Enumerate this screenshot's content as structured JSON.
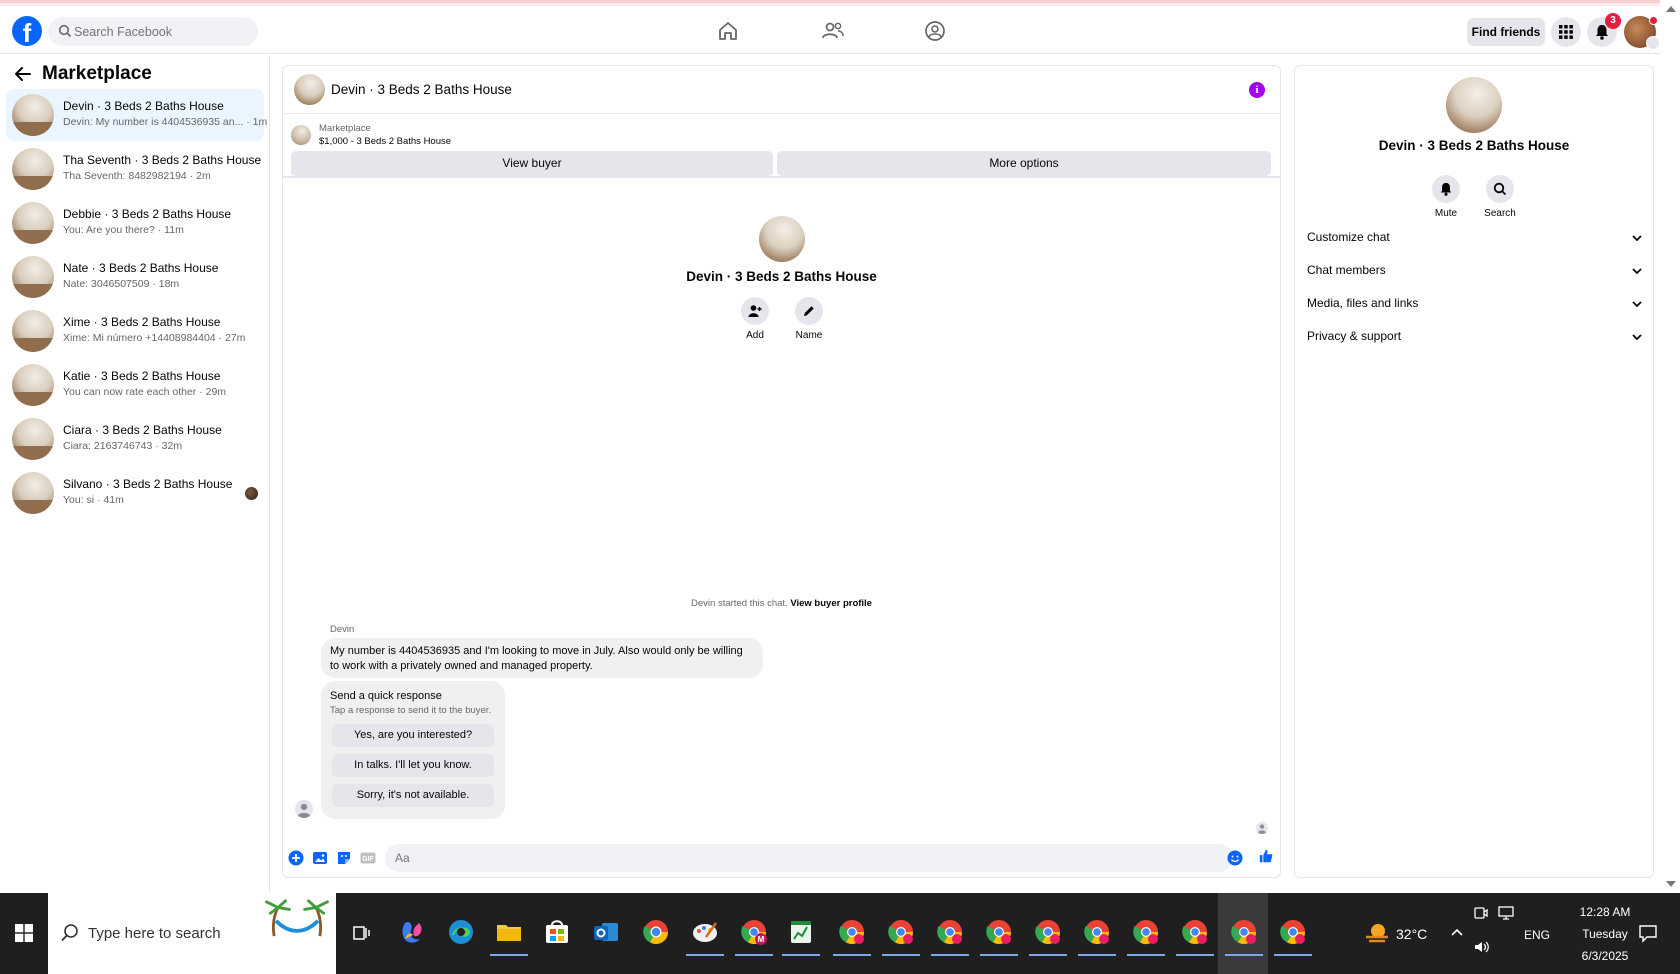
{
  "header": {
    "search_placeholder": "Search Facebook",
    "find_friends": "Find friends",
    "notification_count": "3"
  },
  "sidebar": {
    "title": "Marketplace",
    "conversations": [
      {
        "name": "Devin · 3 Beds 2 Baths House",
        "preview": "Devin: My number is 4404536935 an...  · 1m"
      },
      {
        "name": "Tha Seventh · 3 Beds 2 Baths House",
        "preview": "Tha Seventh: 8482982194 · 2m"
      },
      {
        "name": "Debbie · 3 Beds 2 Baths House",
        "preview": "You: Are you there? · 11m"
      },
      {
        "name": "Nate · 3 Beds 2 Baths House",
        "preview": "Nate: 3046507509 · 18m"
      },
      {
        "name": "Xime · 3 Beds 2 Baths House",
        "preview": "Xime: Mi número +14408984404 · 27m"
      },
      {
        "name": "Katie · 3 Beds 2 Baths House",
        "preview": "You can now rate each other · 29m"
      },
      {
        "name": "Ciara · 3 Beds 2 Baths House",
        "preview": "Ciara: 2163746743 · 32m"
      },
      {
        "name": "Silvano · 3 Beds 2 Baths House",
        "preview": "You: si · 41m"
      }
    ]
  },
  "chat": {
    "title": "Devin · 3 Beds 2 Baths House",
    "marketplace_label": "Marketplace",
    "listing": "$1,000 - 3 Beds 2 Baths House",
    "view_buyer": "View buyer",
    "more_options": "More options",
    "profile_name": "Devin · 3 Beds 2 Baths House",
    "add_label": "Add",
    "name_label": "Name",
    "started_text": "Devin started this chat.",
    "view_buyer_profile": "View buyer profile",
    "sender": "Devin",
    "message": "My number is 4404536935 and I'm looking to move in July. Also would only be willing to work with a privately owned and managed property.",
    "quick_title": "Send a quick response",
    "quick_sub": "Tap a response to send it to the buyer.",
    "quick_responses": [
      "Yes, are you interested?",
      "In talks. I'll let you know.",
      "Sorry, it's not available."
    ],
    "composer_placeholder": "Aa"
  },
  "info_panel": {
    "name": "Devin · 3 Beds 2 Baths House",
    "mute": "Mute",
    "search": "Search",
    "rows": [
      "Customize chat",
      "Chat members",
      "Media, files and links",
      "Privacy & support"
    ]
  },
  "taskbar": {
    "search_placeholder": "Type here to search",
    "temperature": "32°C",
    "language": "ENG",
    "time": "12:28 AM",
    "day": "Tuesday",
    "date": "6/3/2025"
  },
  "colors": {
    "facebook_blue": "#0866ff",
    "active_conversation": "#ebf5ff",
    "info_purple": "#a200ee",
    "notification_red": "#e41e3f",
    "taskbar": "#1f1f1f"
  }
}
